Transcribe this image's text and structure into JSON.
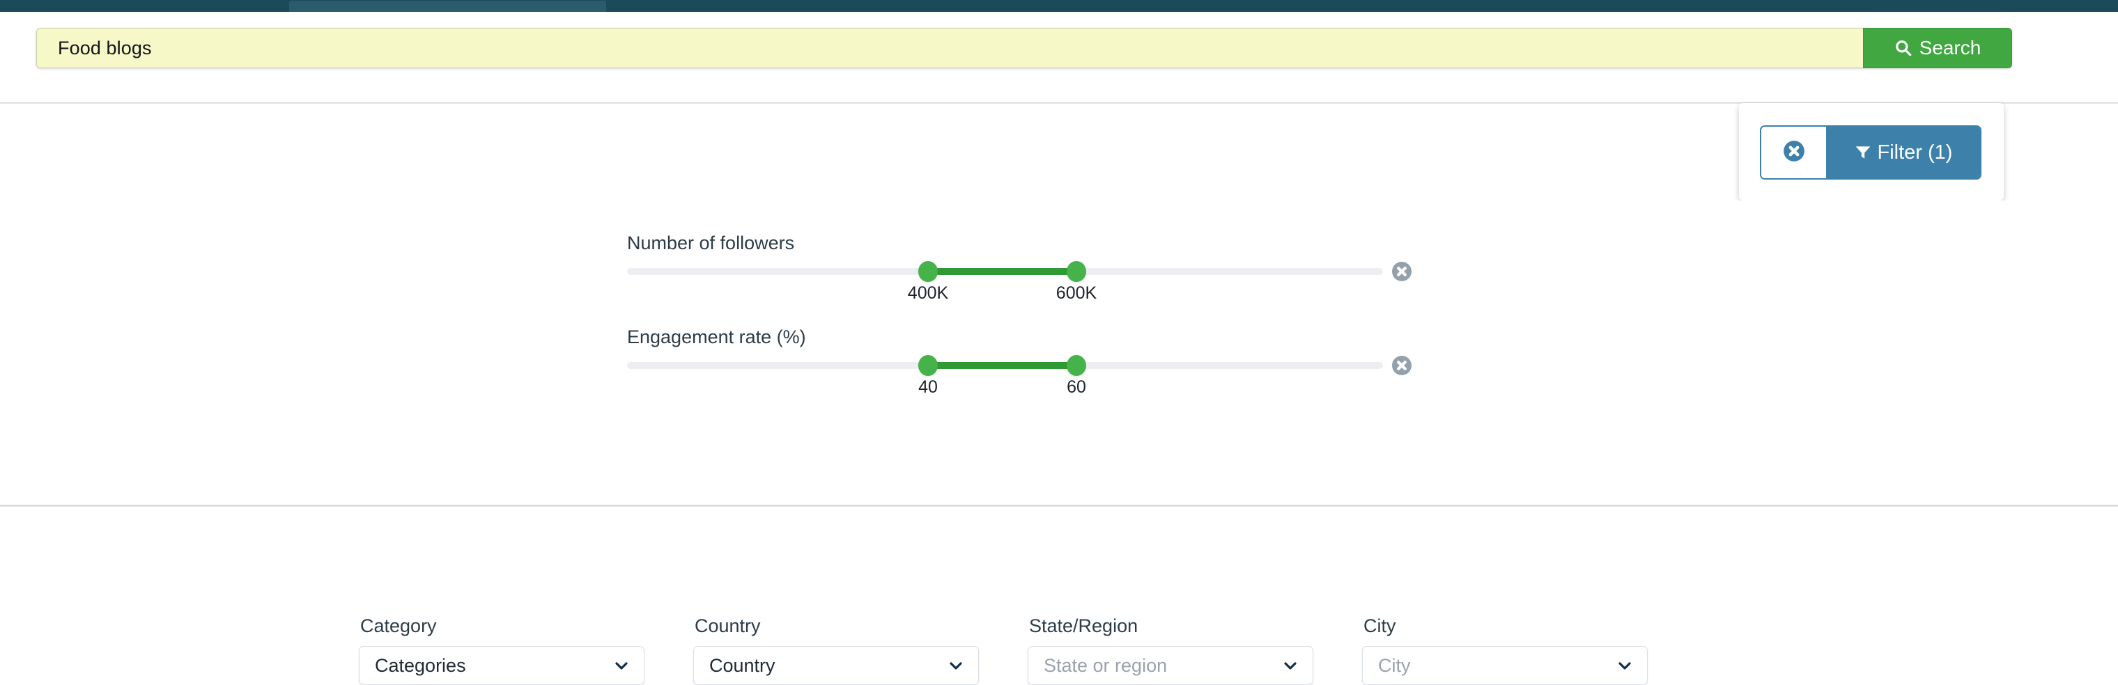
{
  "topbar": {
    "tab_label": ""
  },
  "search": {
    "value": "Food blogs",
    "placeholder": "Search",
    "button_label": "Search",
    "icon": "search-icon",
    "button_color": "#41a741",
    "field_background": "#f6f8c8"
  },
  "filter_card": {
    "clear_icon": "circle-x-icon",
    "filter_icon": "funnel-icon",
    "label": "Filter (1)",
    "accent_color": "#3d81aa"
  },
  "panel": {
    "close_icon": "circle-close-icon",
    "sliders": [
      {
        "label": "Number of followers",
        "min_tick": "400K",
        "max_tick": "600K",
        "clear_icon": "circle-x-icon",
        "track_color": "#eceef2",
        "range_color": "#2f9a33",
        "handle_color": "#46b24a"
      },
      {
        "label": "Engagement rate (%)",
        "min_tick": "40",
        "max_tick": "60",
        "clear_icon": "circle-x-icon",
        "track_color": "#eceef2",
        "range_color": "#2f9a33",
        "handle_color": "#46b24a"
      }
    ],
    "fields": [
      {
        "label": "Category",
        "value": "Categories",
        "is_placeholder": false,
        "caret_icon": "chevron-down-icon"
      },
      {
        "label": "Country",
        "value": "Country",
        "is_placeholder": false,
        "caret_icon": "chevron-down-icon"
      },
      {
        "label": "State/Region",
        "value": "State or region",
        "is_placeholder": true,
        "caret_icon": "chevron-down-icon"
      },
      {
        "label": "City",
        "value": "City",
        "is_placeholder": true,
        "caret_icon": "chevron-down-icon"
      }
    ]
  }
}
